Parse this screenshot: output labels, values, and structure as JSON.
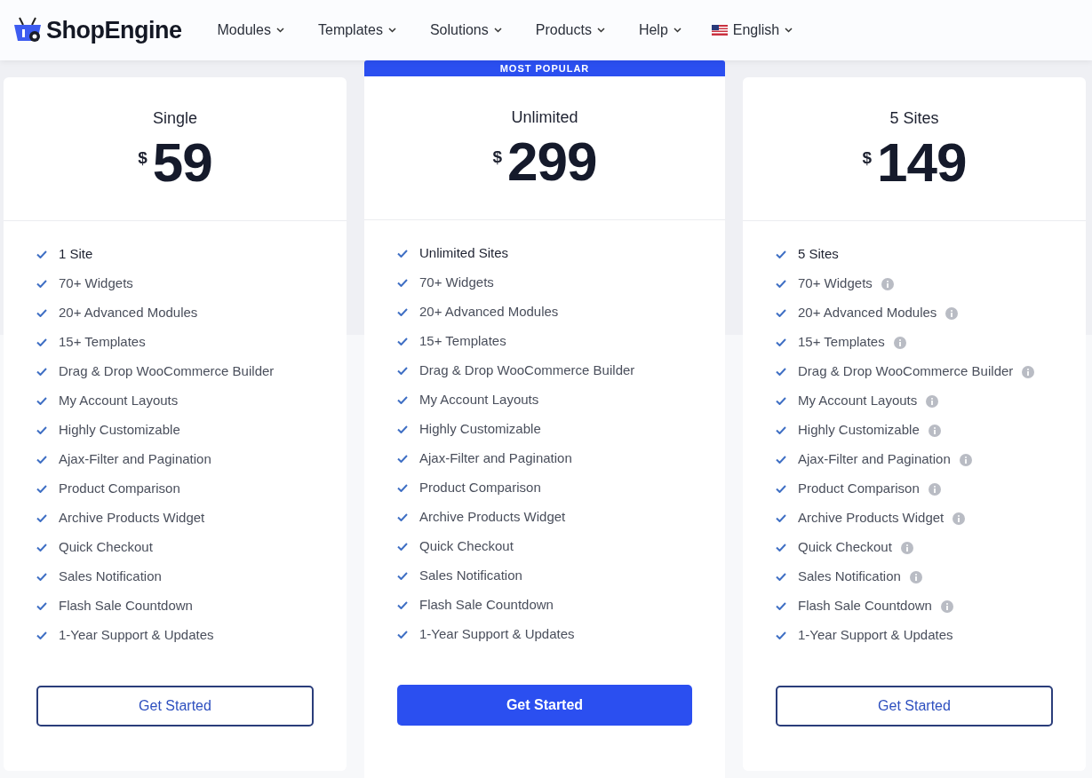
{
  "header": {
    "logo": "ShopEngine",
    "nav": [
      {
        "label": "Modules",
        "kind": "menu"
      },
      {
        "label": "Templates",
        "kind": "menu"
      },
      {
        "label": "Solutions",
        "kind": "menu"
      },
      {
        "label": "Products",
        "kind": "menu"
      },
      {
        "label": "Help",
        "kind": "menu"
      },
      {
        "label": "English",
        "kind": "language"
      }
    ]
  },
  "plans": [
    {
      "name": "Single",
      "currency": "$",
      "price": "59",
      "popular": false,
      "button": "Get Started",
      "features": [
        {
          "text": "1 Site",
          "info": false
        },
        {
          "text": "70+ Widgets",
          "info": false
        },
        {
          "text": "20+ Advanced Modules",
          "info": false
        },
        {
          "text": "15+ Templates",
          "info": false
        },
        {
          "text": "Drag & Drop WooCommerce Builder",
          "info": false
        },
        {
          "text": "My Account Layouts",
          "info": false
        },
        {
          "text": "Highly Customizable",
          "info": false
        },
        {
          "text": "Ajax-Filter and Pagination",
          "info": false
        },
        {
          "text": "Product Comparison",
          "info": false
        },
        {
          "text": "Archive Products Widget",
          "info": false
        },
        {
          "text": "Quick Checkout",
          "info": false
        },
        {
          "text": "Sales Notification",
          "info": false
        },
        {
          "text": "Flash Sale Countdown",
          "info": false
        },
        {
          "text": "1-Year Support & Updates",
          "info": false
        }
      ]
    },
    {
      "name": "Unlimited",
      "currency": "$",
      "price": "299",
      "popular": true,
      "badge": "MOST POPULAR",
      "button": "Get Started",
      "features": [
        {
          "text": "Unlimited Sites",
          "info": false
        },
        {
          "text": "70+ Widgets",
          "info": false
        },
        {
          "text": "20+ Advanced Modules",
          "info": false
        },
        {
          "text": "15+ Templates",
          "info": false
        },
        {
          "text": "Drag & Drop WooCommerce Builder",
          "info": false
        },
        {
          "text": "My Account Layouts",
          "info": false
        },
        {
          "text": "Highly Customizable",
          "info": false
        },
        {
          "text": "Ajax-Filter and Pagination",
          "info": false
        },
        {
          "text": "Product Comparison",
          "info": false
        },
        {
          "text": "Archive Products Widget",
          "info": false
        },
        {
          "text": "Quick Checkout",
          "info": false
        },
        {
          "text": "Sales Notification",
          "info": false
        },
        {
          "text": "Flash Sale Countdown",
          "info": false
        },
        {
          "text": "1-Year Support & Updates",
          "info": false
        }
      ]
    },
    {
      "name": "5 Sites",
      "currency": "$",
      "price": "149",
      "popular": false,
      "button": "Get Started",
      "features": [
        {
          "text": "5 Sites",
          "info": false
        },
        {
          "text": "70+ Widgets",
          "info": true
        },
        {
          "text": "20+ Advanced Modules",
          "info": true
        },
        {
          "text": "15+ Templates",
          "info": true
        },
        {
          "text": "Drag & Drop WooCommerce Builder",
          "info": true
        },
        {
          "text": "My Account Layouts",
          "info": true
        },
        {
          "text": "Highly Customizable",
          "info": true
        },
        {
          "text": "Ajax-Filter and Pagination",
          "info": true
        },
        {
          "text": "Product Comparison",
          "info": true
        },
        {
          "text": "Archive Products Widget",
          "info": true
        },
        {
          "text": "Quick Checkout",
          "info": true
        },
        {
          "text": "Sales Notification",
          "info": true
        },
        {
          "text": "Flash Sale Countdown",
          "info": true
        },
        {
          "text": "1-Year Support & Updates",
          "info": false
        }
      ]
    }
  ]
}
